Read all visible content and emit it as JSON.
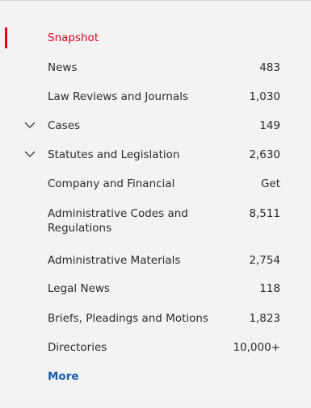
{
  "nav": {
    "snapshot": "Snapshot",
    "items": [
      {
        "label": "News",
        "count": "483"
      },
      {
        "label": "Law Reviews and Journals",
        "count": "1,030"
      },
      {
        "label": "Cases",
        "count": "149"
      },
      {
        "label": "Statutes and Legislation",
        "count": "2,630"
      },
      {
        "label": "Company and Financial",
        "count": "Get"
      },
      {
        "label": "Administrative Codes and Regulations",
        "count": "8,511"
      },
      {
        "label": "Administrative Materials",
        "count": "2,754"
      },
      {
        "label": "Legal News",
        "count": "118"
      },
      {
        "label": "Briefs, Pleadings and Motions",
        "count": "1,823"
      },
      {
        "label": "Directories",
        "count": "10,000+"
      }
    ],
    "more": "More"
  },
  "colors": {
    "active": "#e2001a",
    "link": "#1a5fa8",
    "text": "#2b2b2b",
    "background": "#f3f3f3"
  }
}
